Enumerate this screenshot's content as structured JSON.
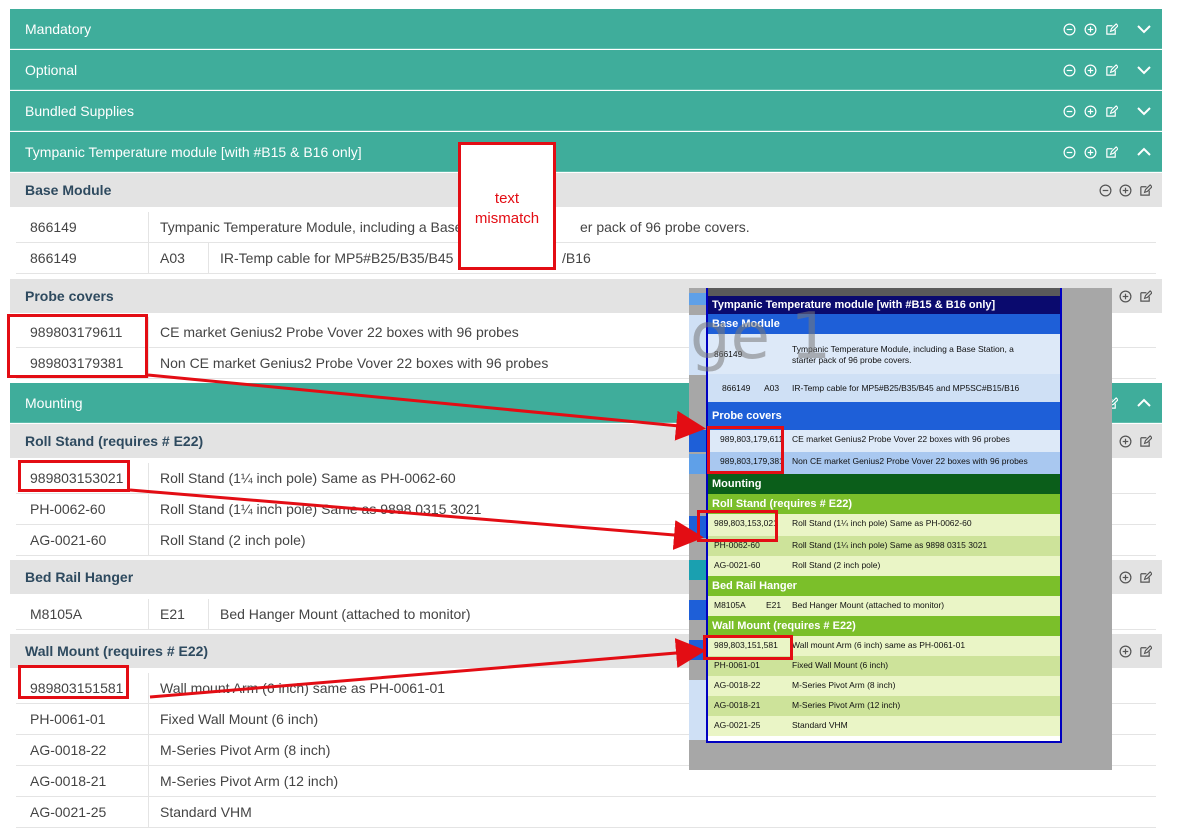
{
  "accordions": [
    {
      "label": "Mandatory",
      "expanded": false
    },
    {
      "label": "Optional",
      "expanded": false
    },
    {
      "label": "Bundled Supplies",
      "expanded": false
    },
    {
      "label": "Tympanic Temperature module [with #B15 & B16 only]",
      "expanded": true
    },
    {
      "label": "Mounting",
      "expanded": true
    }
  ],
  "subheaders": {
    "base_module": "Base Module",
    "probe_covers": "Probe covers",
    "roll_stand": "Roll Stand (requires # E22)",
    "bed_rail": "Bed Rail Hanger",
    "wall_mount": "Wall Mount (requires # E22)"
  },
  "rows": {
    "base1": {
      "code": "866149",
      "desc": "Tympanic Temperature Module, including a Base",
      "desc_tail": "er pack of 96 probe covers."
    },
    "base2": {
      "code": "866149",
      "opt": "A03",
      "desc": "IR-Temp cable for MP5#B25/B35/B45 a",
      "desc_tail": "/B16"
    },
    "probe1": {
      "code": "989803179611",
      "desc": "CE market Genius2 Probe Vover 22 boxes with 96 probes"
    },
    "probe2": {
      "code": "989803179381",
      "desc": "Non CE market Genius2 Probe Vover 22 boxes with 96 probes"
    },
    "roll1": {
      "code": "989803153021",
      "desc": "Roll Stand (1¼ inch pole) Same as PH-0062-60"
    },
    "roll2": {
      "code": "PH-0062-60",
      "desc": "Roll Stand (1¼ inch pole) Same as 9898 0315 3021"
    },
    "roll3": {
      "code": "AG-0021-60",
      "desc": "Roll Stand (2 inch pole)"
    },
    "bed1": {
      "code": "M8105A",
      "opt": "E21",
      "desc": "Bed Hanger Mount (attached to monitor)"
    },
    "wall1": {
      "code": "989803151581",
      "desc": "Wall mount Arm (6 inch) same as PH-0061-01"
    },
    "wall2": {
      "code": "PH-0061-01",
      "desc": "Fixed Wall Mount (6 inch)"
    },
    "wall3": {
      "code": "AG-0018-22",
      "desc": "M-Series Pivot Arm (8 inch)"
    },
    "wall4": {
      "code": "AG-0018-21",
      "desc": "M-Series Pivot Arm (12 inch)"
    },
    "wall5": {
      "code": "AG-0021-25",
      "desc": "Standard VHM"
    }
  },
  "callout": {
    "line1": "text",
    "line2": "mismatch"
  },
  "legacy": {
    "header": "Tympanic Temperature module  [with #B15 & B16 only]",
    "base_module": "Base Module",
    "watermark": "ge 1",
    "base1_code": "866149",
    "base1_desc": "Tympanic Temperature Module, including a Base Station, a",
    "base1_desc2": "starter pack of 96 probe covers.",
    "base2_code": "866149",
    "base2_opt": "A03",
    "base2_desc": "IR-Temp cable for MP5#B25/B35/B45 and MP5SC#B15/B16",
    "probe_covers": "Probe covers",
    "probe1_code": "989,803,179,611",
    "probe1_desc": "CE market Genius2 Probe Vover 22 boxes with 96 probes",
    "probe2_code": "989,803,179,381",
    "probe2_desc": "Non CE market Genius2 Probe Vover 22 boxes with 96 probes",
    "mounting": "Mounting",
    "roll_stand": "Roll Stand (requires # E22)",
    "roll1_code": "989,803,153,021",
    "roll1_desc": "Roll Stand (1¼ inch pole) Same as PH-0062-60",
    "roll2_code": "PH-0062-60",
    "roll2_desc": "Roll Stand (1¼ inch pole) Same as 9898 0315 3021",
    "roll3_code": "AG-0021-60",
    "roll3_desc": "Roll Stand (2 inch pole)",
    "bed_rail": "Bed Rail Hanger",
    "bed1_code": "M8105A",
    "bed1_opt": "E21",
    "bed1_desc": "Bed Hanger Mount (attached to monitor)",
    "wall_mount": "Wall Mount (requires # E22)",
    "wall1_code": "989,803,151,581",
    "wall1_desc": "Wall mount Arm (6 inch)  same as PH-0061-01",
    "wall2_code": "PH-0061-01",
    "wall2_desc": "Fixed Wall Mount (6 inch)",
    "wall3_code": "AG-0018-22",
    "wall3_desc": "M-Series Pivot Arm (8 inch)",
    "wall4_code": "AG-0018-21",
    "wall4_desc": "M-Series Pivot Arm (12 inch)",
    "wall5_code": "AG-0021-25",
    "wall5_desc": "Standard VHM"
  },
  "colors": {
    "teal": "#3fad9b",
    "subheader": "#e3e3e3",
    "highlight_red": "#e30d14",
    "legacy_navy": "#0a0a6e",
    "legacy_blue": "#1e5fd8",
    "legacy_green_dark": "#0b5e1a",
    "legacy_green": "#7bbf2a",
    "legacy_green_light": "#eaf5c6"
  }
}
